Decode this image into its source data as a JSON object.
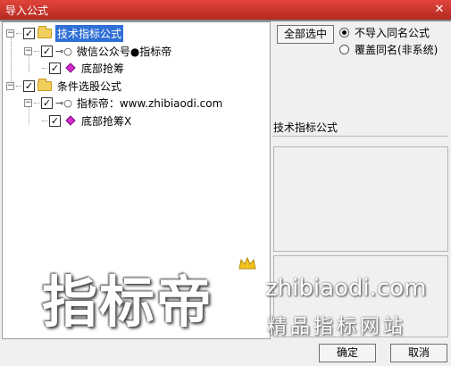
{
  "window": {
    "title": "导入公式",
    "close_label": "✕"
  },
  "tree": [
    {
      "label": "技术指标公式",
      "expander": "−",
      "checked": true,
      "selected": true,
      "icon": "folder-icon"
    },
    {
      "label": "微信公众号●指标帝",
      "expander": "−",
      "checked": true,
      "icon": "key-icon"
    },
    {
      "label": "底部抢筹",
      "checked": true,
      "icon": "formula-diamond-icon"
    },
    {
      "label": "条件选股公式",
      "expander": "−",
      "checked": true,
      "icon": "folder-icon"
    },
    {
      "label": "指标帝：www.zhibiaodi.com",
      "expander": "−",
      "checked": true,
      "icon": "key-icon"
    },
    {
      "label": "底部抢筹X",
      "checked": true,
      "icon": "formula-diamond-icon"
    }
  ],
  "options": {
    "select_all_label": "全部选中",
    "radio_skip_label": "不导入同名公式",
    "radio_overwrite_label": "覆盖同名(非系统)",
    "selected_radio": "skip"
  },
  "info": {
    "category_label": "技术指标公式"
  },
  "footer": {
    "ok_label": "确定",
    "cancel_label": "取消"
  },
  "watermark": {
    "brand_text": "指标帝",
    "url_text": "zhibiaodi.com",
    "slogan_text": "精品指标网站"
  },
  "colors": {
    "titlebar": "#c7342a",
    "selection": "#2f6fd6",
    "folder": "#f2cf5b",
    "diamond": "#d52bd0"
  }
}
